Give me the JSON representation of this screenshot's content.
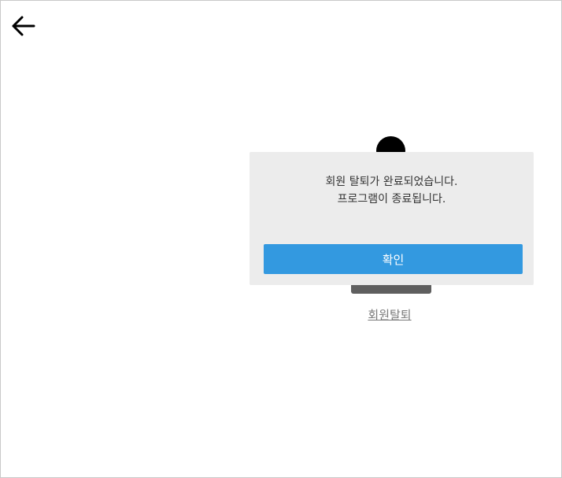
{
  "header": {
    "back_icon": "arrow-left-icon"
  },
  "page": {
    "withdraw_link": "회원탈퇴"
  },
  "dialog": {
    "message_line1": "회원 탈퇴가 완료되었습니다.",
    "message_line2": "프로그램이 종료됩니다.",
    "confirm_label": "확인"
  },
  "colors": {
    "confirm_button": "#3399e0",
    "dialog_background": "#ececec"
  }
}
